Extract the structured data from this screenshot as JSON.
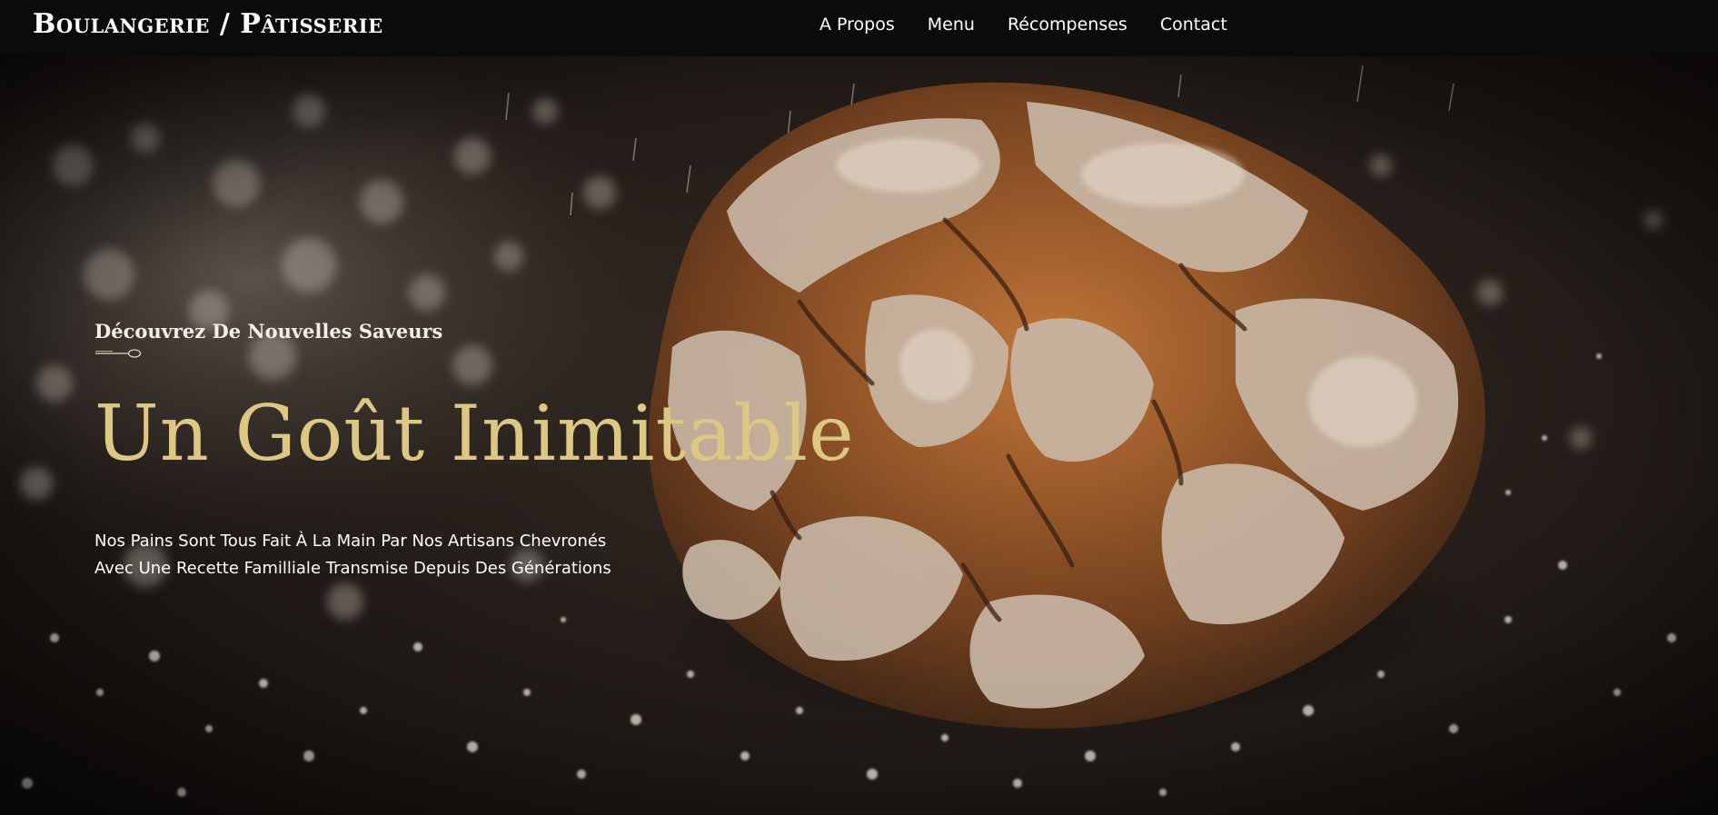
{
  "header": {
    "brand": "Boulangerie / Pâtisserie",
    "nav": [
      {
        "label": "A Propos"
      },
      {
        "label": "Menu"
      },
      {
        "label": "Récompenses"
      },
      {
        "label": "Contact"
      }
    ]
  },
  "hero": {
    "subheading": "Découvrez De Nouvelles Saveurs",
    "title": "Un Goût Inimitable",
    "description_lines": [
      "Nos Pains Sont Tous Fait À La Main Par Nos Artisans Chevronés",
      "Avec Une Recette Familliale Transmise Depuis Des Générations"
    ],
    "background_image": "bread-loaf-with-flour",
    "ornament_icon": "spoon-icon"
  },
  "colors": {
    "navbar_bg": "#0b0b0b",
    "title_gold": "#dcc784",
    "text_white": "#ffffff"
  }
}
